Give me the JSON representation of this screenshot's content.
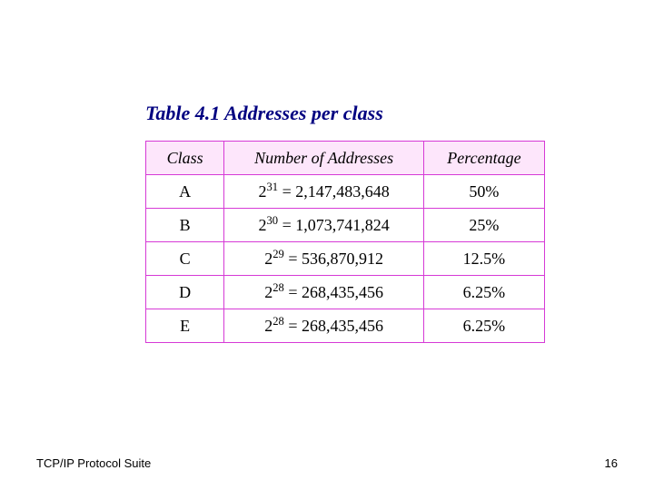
{
  "title": "Table 4.1  Addresses per class",
  "headers": {
    "class": "Class",
    "number": "Number of Addresses",
    "percentage": "Percentage"
  },
  "rows": [
    {
      "class": "A",
      "exp": "31",
      "value": "2,147,483,648",
      "percentage": "50%"
    },
    {
      "class": "B",
      "exp": "30",
      "value": "1,073,741,824",
      "percentage": "25%"
    },
    {
      "class": "C",
      "exp": "29",
      "value": "536,870,912",
      "percentage": "12.5%"
    },
    {
      "class": "D",
      "exp": "28",
      "value": "268,435,456",
      "percentage": "6.25%"
    },
    {
      "class": "E",
      "exp": "28",
      "value": "268,435,456",
      "percentage": "6.25%"
    }
  ],
  "footer": {
    "left": "TCP/IP Protocol Suite",
    "right": "16"
  },
  "chart_data": {
    "type": "table",
    "title": "Table 4.1 Addresses per class",
    "columns": [
      "Class",
      "Number of Addresses",
      "Percentage"
    ],
    "data": [
      {
        "class": "A",
        "addresses": 2147483648,
        "formula": "2^31",
        "percentage": 50.0
      },
      {
        "class": "B",
        "addresses": 1073741824,
        "formula": "2^30",
        "percentage": 25.0
      },
      {
        "class": "C",
        "addresses": 536870912,
        "formula": "2^29",
        "percentage": 12.5
      },
      {
        "class": "D",
        "addresses": 268435456,
        "formula": "2^28",
        "percentage": 6.25
      },
      {
        "class": "E",
        "addresses": 268435456,
        "formula": "2^28",
        "percentage": 6.25
      }
    ]
  }
}
